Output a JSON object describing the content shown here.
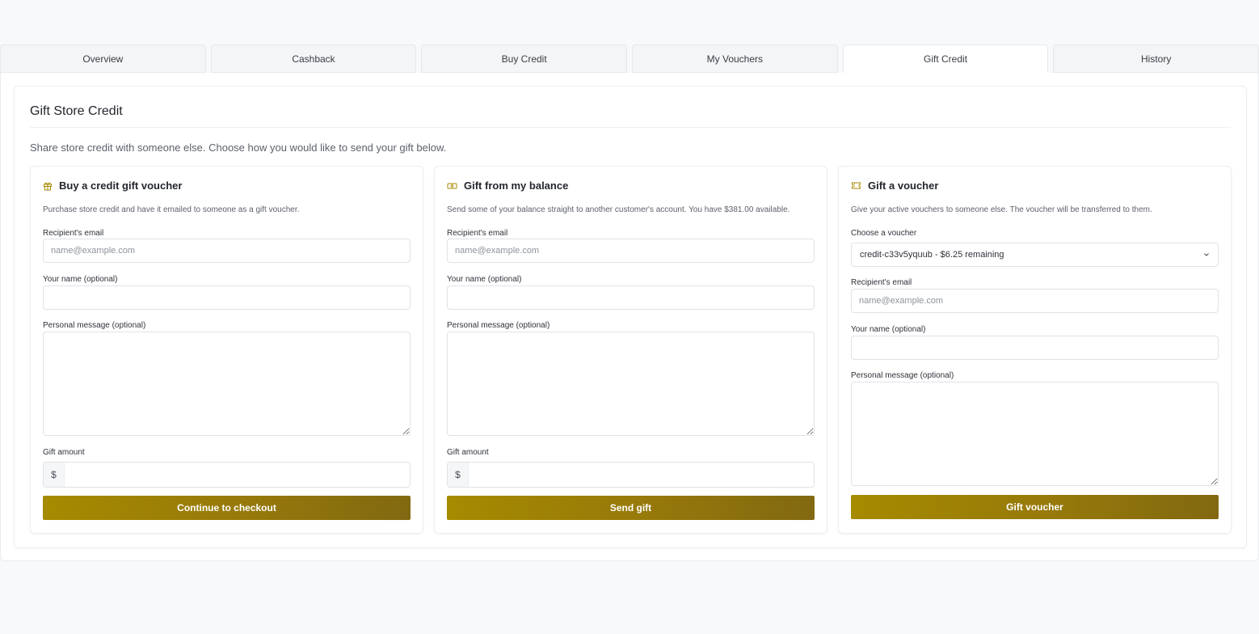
{
  "tabs": [
    {
      "label": "Overview"
    },
    {
      "label": "Cashback"
    },
    {
      "label": "Buy Credit"
    },
    {
      "label": "My Vouchers"
    },
    {
      "label": "Gift Credit",
      "active": true
    },
    {
      "label": "History"
    }
  ],
  "page": {
    "title": "Gift Store Credit",
    "intro": "Share store credit with someone else. Choose how you would like to send your gift below."
  },
  "colors": {
    "accent": "#a68a00",
    "accent_dark": "#826811"
  },
  "buy_voucher": {
    "icon": "gift-icon",
    "title": "Buy a credit gift voucher",
    "description": "Purchase store credit and have it emailed to someone as a gift voucher.",
    "email_label": "Recipient's email",
    "email_placeholder": "name@example.com",
    "name_label": "Your name (optional)",
    "message_label": "Personal message (optional)",
    "amount_label": "Gift amount",
    "currency_symbol": "$",
    "button_label": "Continue to checkout"
  },
  "from_balance": {
    "icon": "banknote-icon",
    "title": "Gift from my balance",
    "description": "Send some of your balance straight to another customer's account. You have $381.00 available.",
    "email_label": "Recipient's email",
    "email_placeholder": "name@example.com",
    "name_label": "Your name (optional)",
    "message_label": "Personal message (optional)",
    "amount_label": "Gift amount",
    "currency_symbol": "$",
    "button_label": "Send gift"
  },
  "gift_voucher": {
    "icon": "ticket-icon",
    "title": "Gift a voucher",
    "description": "Give your active vouchers to someone else. The voucher will be transferred to them.",
    "choose_label": "Choose a voucher",
    "selected_voucher": "credit-c33v5yquub - $6.25 remaining",
    "email_label": "Recipient's email",
    "email_placeholder": "name@example.com",
    "name_label": "Your name (optional)",
    "message_label": "Personal message (optional)",
    "button_label": "Gift voucher"
  }
}
